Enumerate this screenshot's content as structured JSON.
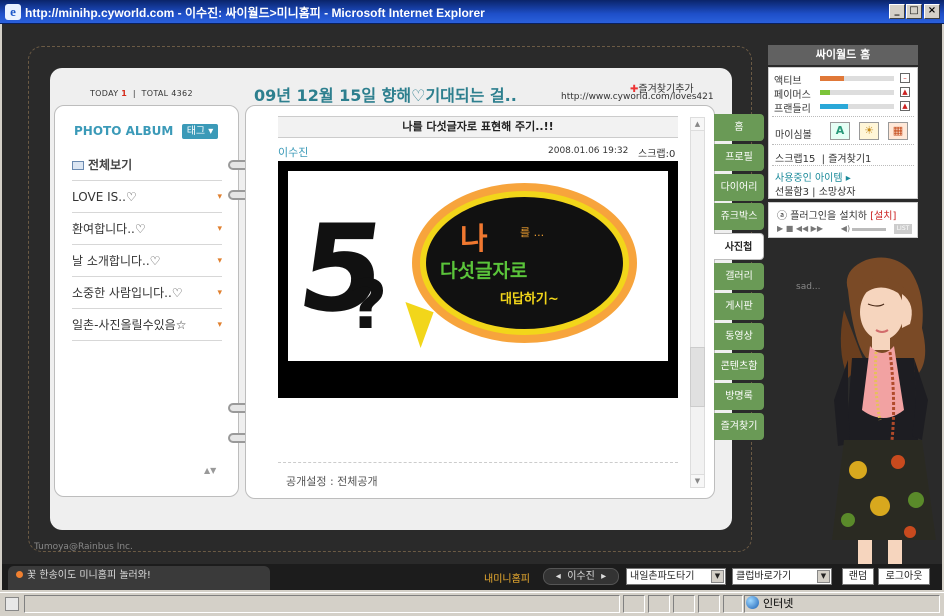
{
  "window": {
    "title": "http://minihp.cyworld.com - 이수진: 싸이월드>미니홈피 - Microsoft Internet Explorer"
  },
  "header": {
    "today_label": "TODAY",
    "today_count": "1",
    "total_label": "TOTAL",
    "total_count": "4362",
    "headline": "09년 12월 15일 향해♡기대되는 걸..",
    "fav_add": "즐겨찾기추가",
    "home_url": "http://www.cyworld.com/loves421"
  },
  "album": {
    "title": "PHOTO ALBUM",
    "tag_button": "태그",
    "view_all": "전체보기",
    "folders": [
      {
        "label": "LOVE IS..♡"
      },
      {
        "label": "환여합니다..♡"
      },
      {
        "label": "날 소개합니다..♡"
      },
      {
        "label": "소중한 사람입니다..♡"
      },
      {
        "label": "일촌-사진올릴수있음☆"
      }
    ]
  },
  "post": {
    "title": "나를 다섯글자로 표현해 주기..!!",
    "author": "이수진",
    "date": "2008.01.06 19:32",
    "scrap": "스크랩:0",
    "image_text": {
      "five": "5",
      "question": "?",
      "na": "나",
      "reul": "를 ...",
      "line2": "다섯글자로",
      "line3": "대답하기~"
    },
    "visibility": "공개설정 : 전체공개"
  },
  "tabs": [
    "홈",
    "프로필",
    "다이어리",
    "쥬크박스",
    "사진첩",
    "갤러리",
    "게시판",
    "동영상",
    "콘텐츠함",
    "방명록",
    "즐겨찾기"
  ],
  "active_tab": "사진첩",
  "cyworld": {
    "home": "싸이월드 홈",
    "stats": [
      {
        "label": "액티브",
        "level": 0.32,
        "color": "#e07838"
      },
      {
        "label": "페이머스",
        "level": 0.14,
        "color": "#7cc43a"
      },
      {
        "label": "프랜들리",
        "level": 0.38,
        "color": "#2aa8d8"
      }
    ],
    "mysim": "마이심볼",
    "scrap": "스크랩15",
    "favorites": "즐겨찾기1",
    "using_items": "사용중인 아이템",
    "gift": "선물함3",
    "wish": "소망상자"
  },
  "plugin": {
    "text": "플러그인을 설치하",
    "install": "[설치]",
    "list": "LIST"
  },
  "mood": "sad...",
  "copyright": "Tumoya@Rainbus Inc.",
  "bottom": {
    "notice": "꽃 한송이도 미니홈피 놀러와!",
    "my_minihompy": "내미니홈피",
    "owner": "이수진",
    "wave": "내일촌파도타기",
    "club": "클럽바로가기",
    "random": "랜덤",
    "logout": "로그아웃"
  },
  "statusbar": {
    "zone": "인터넷"
  }
}
